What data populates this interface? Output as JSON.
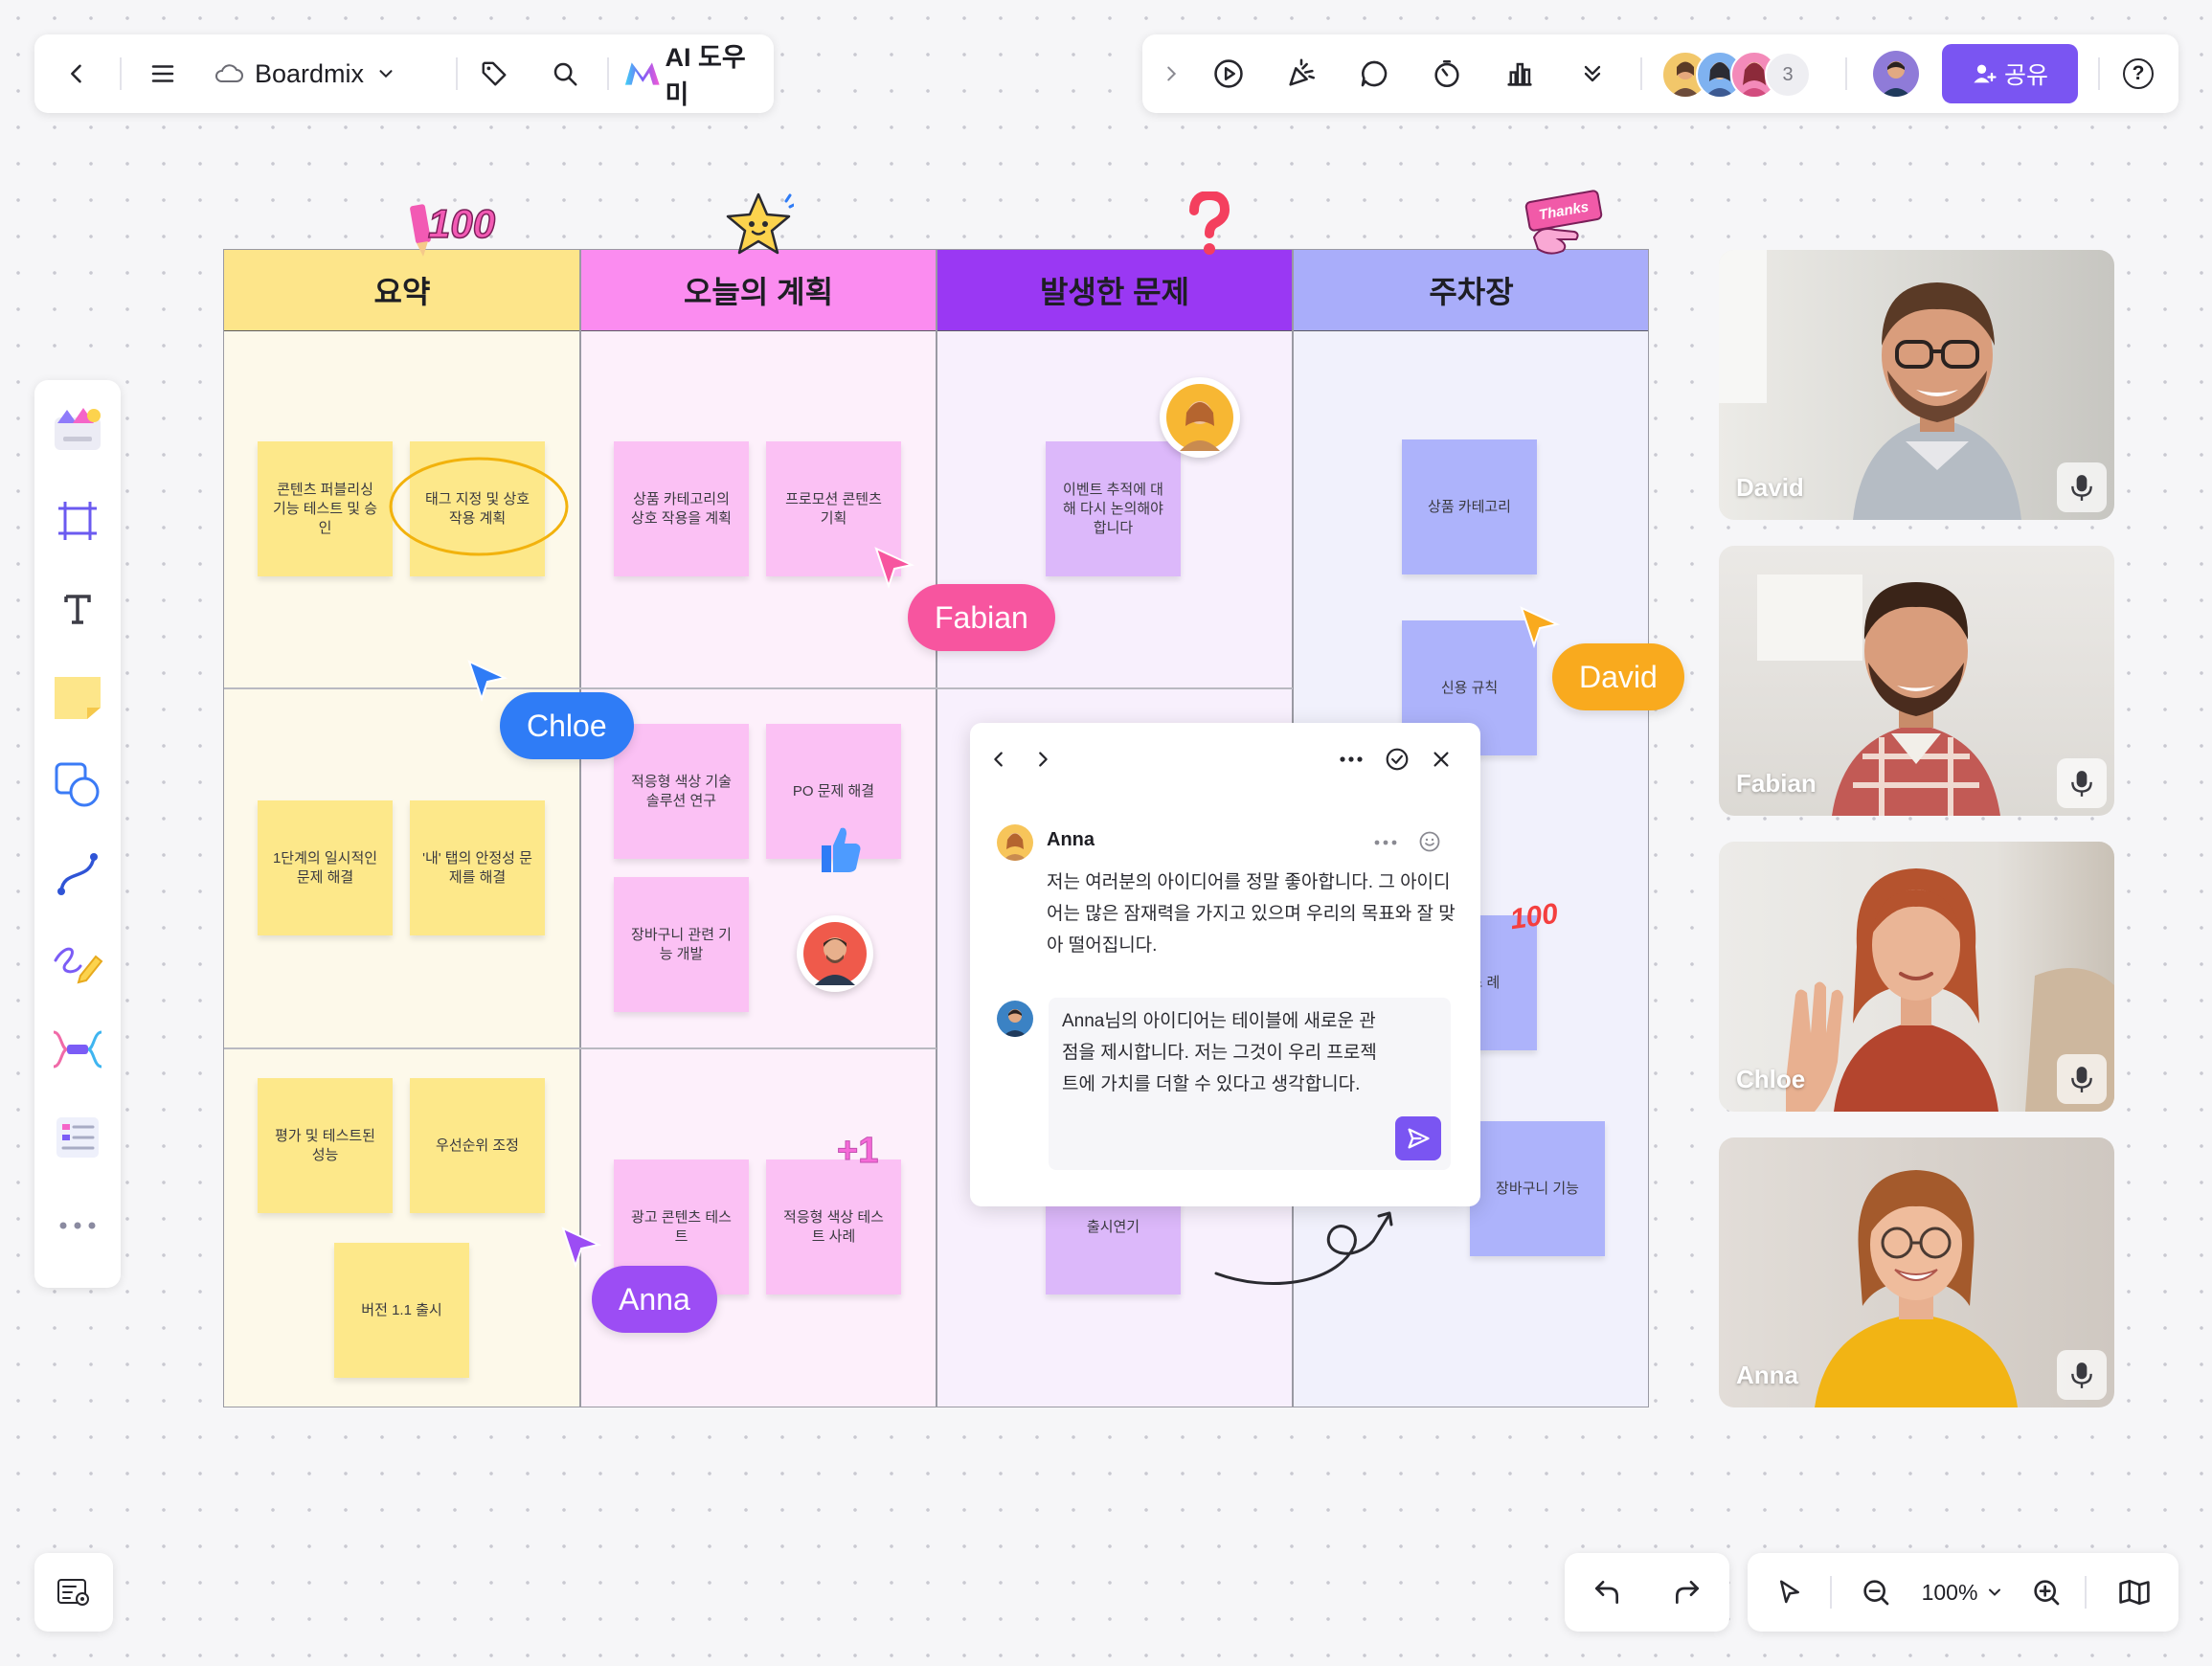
{
  "app": {
    "name": "Boardmix",
    "ai_label": "AI 도우미"
  },
  "toolbar_right": {
    "collaborator_count": "3",
    "share_label": "공유",
    "help_label": "?"
  },
  "board": {
    "columns": [
      {
        "title": "요약",
        "color": "#fde58a"
      },
      {
        "title": "오늘의 계획",
        "color": "#fb8cf0"
      },
      {
        "title": "발생한 문제",
        "color": "#9a38f3"
      },
      {
        "title": "주차장",
        "color": "#a9adfa"
      }
    ],
    "stickies": {
      "summary": [
        "콘텐츠 퍼블리싱 기능 테스트 및 승인",
        "태그 지정 및 상호 작용 계획",
        "1단계의 일시적인 문제 해결",
        "'내' 탭의 안정성 문제를 해결",
        "평가 및 테스트된 성능",
        "우선순위 조정",
        "버전 1.1 출시"
      ],
      "plan": [
        "상품 카테고리의 상호 작용을 계획",
        "프로모션 콘텐츠 기획",
        "적응형 색상 기술 솔루션 연구",
        "PO 문제 해결",
        "장바구니 관련 기능 개발",
        "광고 콘텐츠 테스트",
        "적응형 색상 테스트 사례"
      ],
      "issues": [
        "이벤트 추적에 대해 다시 논의해야 합니다",
        "출시연기"
      ],
      "parking": [
        "상품 카테고리",
        "신용 규칙",
        "상 테스 례",
        "장바구니 기능"
      ]
    },
    "stickers": {
      "hundred_top": "100",
      "thanks": "Thanks",
      "plus_one": "+1",
      "hundred_small": "100"
    }
  },
  "cursors": [
    {
      "name": "Fabian",
      "color": "#f7559f"
    },
    {
      "name": "Chloe",
      "color": "#2f7cf6"
    },
    {
      "name": "David",
      "color": "#f9aa1e"
    },
    {
      "name": "Anna",
      "color": "#9c4df4"
    }
  ],
  "comment": {
    "author": "Anna",
    "message": "저는 여러분의 아이디어를 정말 좋아합니다. 그 아이디어는 많은 잠재력을 가지고 있으며 우리의 목표와 잘 맞아 떨어집니다.",
    "reply": "Anna님의 아이디어는 테이블에 새로운 관점을 제시합니다. 저는 그것이 우리 프로젝트에 가치를 더할 수 있다고 생각합니다."
  },
  "participants": [
    {
      "name": "David"
    },
    {
      "name": "Fabian"
    },
    {
      "name": "Chloe"
    },
    {
      "name": "Anna"
    }
  ],
  "zoom": "100%"
}
